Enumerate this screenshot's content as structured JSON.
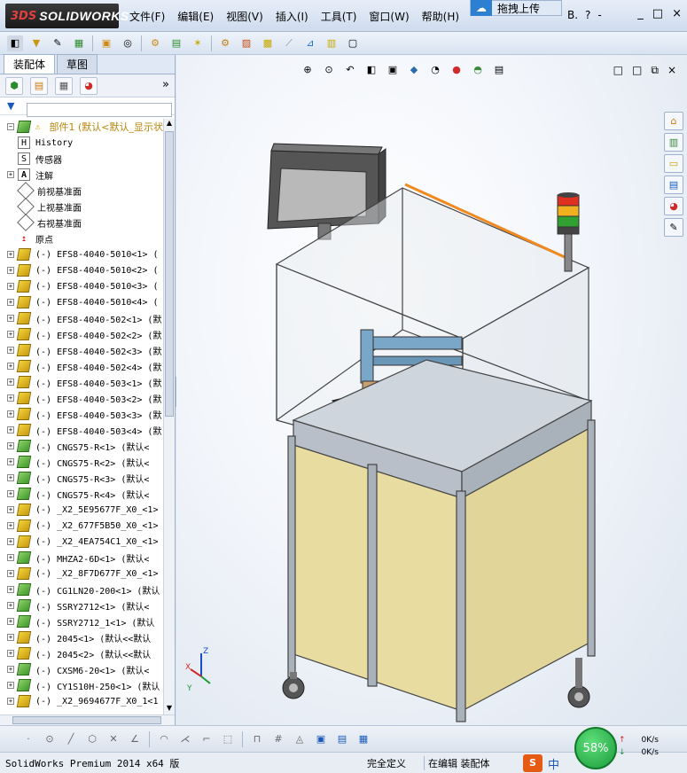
{
  "app": {
    "brand_prefix": "3DS",
    "brand": "SOLIDWORKS",
    "menu": [
      "文件(F)",
      "编辑(E)",
      "视图(V)",
      "插入(I)",
      "工具(T)",
      "窗口(W)",
      "帮助(H)"
    ],
    "upload_badge": "拖拽上传",
    "title_tools": [
      "B.",
      "?",
      "-"
    ],
    "window_controls": [
      "_",
      "□",
      "×"
    ]
  },
  "left_panel": {
    "tabs": [
      "装配体",
      "草图"
    ],
    "active_tab": "装配体",
    "expand_arrow": "»",
    "tree": {
      "root_label": "部件1  (默认<默认_显示状",
      "items": [
        {
          "label": "History",
          "icon": "history-icon",
          "expand": false
        },
        {
          "label": "传感器",
          "icon": "sensor-icon",
          "expand": false
        },
        {
          "label": "注解",
          "icon": "annotation-icon",
          "expand": true
        },
        {
          "label": "前视基准面",
          "icon": "plane-icon",
          "expand": false
        },
        {
          "label": "上视基准面",
          "icon": "plane-icon",
          "expand": false
        },
        {
          "label": "右视基准面",
          "icon": "plane-icon",
          "expand": false
        },
        {
          "label": "原点",
          "icon": "origin-icon",
          "expand": false
        },
        {
          "label": "(-) EFS8-4040-5010<1> (",
          "icon": "part-icon",
          "expand": true
        },
        {
          "label": "(-) EFS8-4040-5010<2> (",
          "icon": "part-icon",
          "expand": true
        },
        {
          "label": "(-) EFS8-4040-5010<3> (",
          "icon": "part-icon",
          "expand": true
        },
        {
          "label": "(-) EFS8-4040-5010<4> (",
          "icon": "part-icon",
          "expand": true
        },
        {
          "label": "(-) EFS8-4040-502<1> (默",
          "icon": "part-icon",
          "expand": true
        },
        {
          "label": "(-) EFS8-4040-502<2> (默",
          "icon": "part-icon",
          "expand": true
        },
        {
          "label": "(-) EFS8-4040-502<3> (默",
          "icon": "part-icon",
          "expand": true
        },
        {
          "label": "(-) EFS8-4040-502<4> (默",
          "icon": "part-icon",
          "expand": true
        },
        {
          "label": "(-) EFS8-4040-503<1> (默",
          "icon": "part-icon",
          "expand": true
        },
        {
          "label": "(-) EFS8-4040-503<2> (默",
          "icon": "part-icon",
          "expand": true
        },
        {
          "label": "(-) EFS8-4040-503<3> (默",
          "icon": "part-icon",
          "expand": true
        },
        {
          "label": "(-) EFS8-4040-503<4> (默",
          "icon": "part-icon",
          "expand": true
        },
        {
          "label": "(-) CNGS75-R<1> (默认<",
          "icon": "assembly-icon",
          "expand": true
        },
        {
          "label": "(-) CNGS75-R<2> (默认<",
          "icon": "assembly-icon",
          "expand": true
        },
        {
          "label": "(-) CNGS75-R<3> (默认<",
          "icon": "assembly-icon",
          "expand": true
        },
        {
          "label": "(-) CNGS75-R<4> (默认<",
          "icon": "assembly-icon",
          "expand": true
        },
        {
          "label": "(-) _X2_5E95677F_X0_<1>",
          "icon": "part-icon",
          "expand": true
        },
        {
          "label": "(-) _X2_677F5B50_X0_<1>",
          "icon": "part-icon",
          "expand": true
        },
        {
          "label": "(-) _X2_4EA754C1_X0_<1>",
          "icon": "part-icon",
          "expand": true
        },
        {
          "label": "(-) MHZA2-6D<1> (默认<",
          "icon": "assembly-icon",
          "expand": true
        },
        {
          "label": "(-) _X2_8F7D677F_X0_<1>",
          "icon": "part-icon",
          "expand": true
        },
        {
          "label": "(-) CG1LN20-200<1> (默认",
          "icon": "assembly-icon",
          "expand": true
        },
        {
          "label": "(-) SSRY2712<1> (默认<",
          "icon": "assembly-icon",
          "expand": true
        },
        {
          "label": "(-) SSRY2712_1<1> (默认",
          "icon": "assembly-icon",
          "expand": true
        },
        {
          "label": "(-) 2045<1> (默认<<默认",
          "icon": "part-icon",
          "expand": true
        },
        {
          "label": "(-) 2045<2> (默认<<默认",
          "icon": "part-icon",
          "expand": true
        },
        {
          "label": "(-) CXSM6-20<1> (默认<",
          "icon": "assembly-icon",
          "expand": true
        },
        {
          "label": "(-) CY1S10H-250<1> (默认",
          "icon": "assembly-icon",
          "expand": true
        },
        {
          "label": "(-) _X2_9694677F_X0_1<1",
          "icon": "part-icon",
          "expand": true
        }
      ]
    }
  },
  "viewport": {
    "triad": {
      "x": "X",
      "y": "Y",
      "z": "Z"
    },
    "view_controls": [
      "□",
      "□",
      "⧉",
      "×"
    ]
  },
  "status": {
    "product": "SolidWorks Premium 2014 x64 版",
    "definition": "完全定义",
    "mode": "在编辑 装配体",
    "ime_logo": "S",
    "ime_lang": "中",
    "net_percent": "58%",
    "upload_speed": "0K/s",
    "download_speed": "0K/s"
  }
}
